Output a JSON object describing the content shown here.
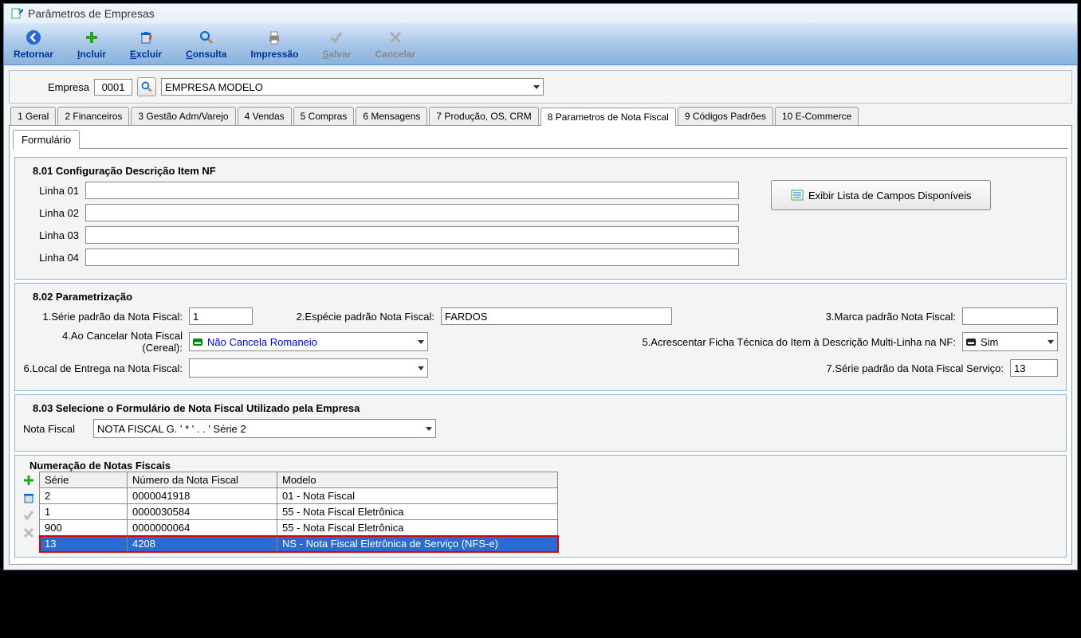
{
  "title": "Parâmetros de Empresas",
  "toolbar": {
    "retornar": "Retornar",
    "incluir": "Incluir",
    "excluir": "Excluir",
    "consulta": "Consulta",
    "impressao": "Impressão",
    "salvar": "Salvar",
    "cancelar": "Cancelar"
  },
  "empresa": {
    "label": "Empresa",
    "code": "0001",
    "name": "EMPRESA MODELO"
  },
  "tabs": {
    "t1": "1 Geral",
    "t2": "2 Financeiros",
    "t3": "3 Gestão Adm/Varejo",
    "t4": "4 Vendas",
    "t5": "5 Compras",
    "t6": "6 Mensagens",
    "t7": "7 Produção, OS, CRM",
    "t8": "8 Parametros de Nota Fiscal",
    "t9": "9 Códigos Padrões",
    "t10": "10 E-Commerce"
  },
  "subtab": "Formulário",
  "g801": {
    "legend": "8.01 Configuração Descrição Item NF",
    "l1": "Linha 01",
    "l2": "Linha 02",
    "l3": "Linha 03",
    "l4": "Linha 04",
    "btn": "Exibir Lista de Campos Disponíveis"
  },
  "g802": {
    "legend": "8.02 Parametrização",
    "f1": "1.Série padrão da Nota Fiscal:",
    "f1v": "1",
    "f2": "2.Espécie padrão Nota Fiscal:",
    "f2v": "FARDOS",
    "f3": "3.Marca padrão Nota Fiscal:",
    "f3v": "",
    "f4": "4.Ao Cancelar Nota Fiscal (Cereal):",
    "f4v": "Não Cancela Romaneio",
    "f5": "5.Acrescentar Ficha Técnica do Item à Descrição Multi-Linha na NF:",
    "f5v": "Sim",
    "f6": "6.Local de Entrega na Nota Fiscal:",
    "f6v": "",
    "f7": "7.Série padrão da Nota Fiscal Serviço:",
    "f7v": "13"
  },
  "g803": {
    "legend": "8.03 Selecione o Formulário de Nota Fiscal Utilizado pela Empresa",
    "label": "Nota Fiscal",
    "value": "NOTA FISCAL G. ' * ' . . ' Série 2"
  },
  "grid": {
    "legend": "Numeração de Notas Fiscais",
    "h1": "Série",
    "h2": "Número da Nota Fiscal",
    "h3": "Modelo",
    "rows": [
      {
        "serie": "2",
        "numero": "0000041918",
        "modelo": "01 - Nota Fiscal"
      },
      {
        "serie": "1",
        "numero": "0000030584",
        "modelo": "55 - Nota Fiscal Eletrônica"
      },
      {
        "serie": "900",
        "numero": "0000000064",
        "modelo": "55 - Nota Fiscal Eletrônica"
      },
      {
        "serie": "13",
        "numero": "4208",
        "modelo": "NS - Nota Fiscal Eletrônica de Serviço (NFS-e)"
      }
    ]
  }
}
